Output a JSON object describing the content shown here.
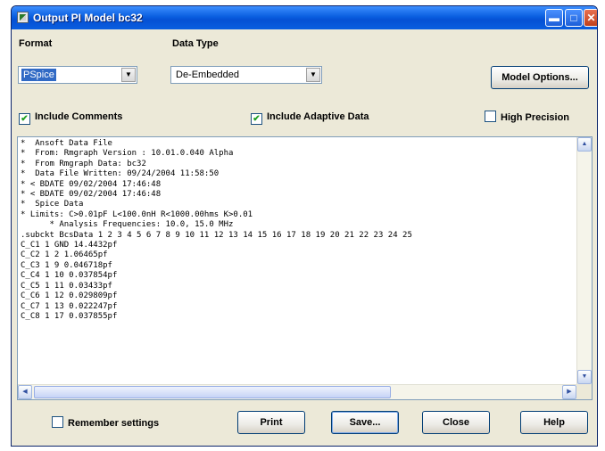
{
  "window": {
    "title": "Output PI Model bc32"
  },
  "format": {
    "label": "Format",
    "value": "PSpice"
  },
  "data_type": {
    "label": "Data Type",
    "value": "De-Embedded"
  },
  "buttons": {
    "model_options": "Model Options...",
    "print": "Print",
    "save": "Save...",
    "close": "Close",
    "help": "Help"
  },
  "checks": {
    "include_comments": {
      "label": "Include Comments",
      "checked": true
    },
    "include_adaptive": {
      "label": "Include Adaptive Data",
      "checked": true
    },
    "high_precision": {
      "label": "High Precision",
      "checked": false
    },
    "remember": {
      "label": "Remember settings",
      "checked": false
    }
  },
  "text": {
    "lines": [
      "*  Ansoft Data File",
      "*  From: Rmgraph Version : 10.01.0.040 Alpha",
      "*  From Rmgraph Data: bc32",
      "*  Data File Written: 09/24/2004 11:58:50",
      "* < BDATE 09/02/2004 17:46:48",
      "* < BDATE 09/02/2004 17:46:48",
      "*  Spice Data",
      "* Limits: C>0.01pF L<100.0nH R<1000.00hms K>0.01",
      "      * Analysis Frequencies: 10.0, 15.0 MHz",
      ".subckt BcsData 1 2 3 4 5 6 7 8 9 10 11 12 13 14 15 16 17 18 19 20 21 22 23 24 25",
      "C_C1 1 GND 14.4432pf",
      "C_C2 1 2 1.06465pf",
      "C_C3 1 9 0.046718pf",
      "C_C4 1 10 0.037854pf",
      "C_C5 1 11 0.03433pf",
      "C_C6 1 12 0.029809pf",
      "C_C7 1 13 0.022247pf",
      "C_C8 1 17 0.037855pf"
    ]
  },
  "icons": {
    "app": "app-icon",
    "minimize": "minimize-icon",
    "maximize": "maximize-icon",
    "close": "close-icon"
  }
}
